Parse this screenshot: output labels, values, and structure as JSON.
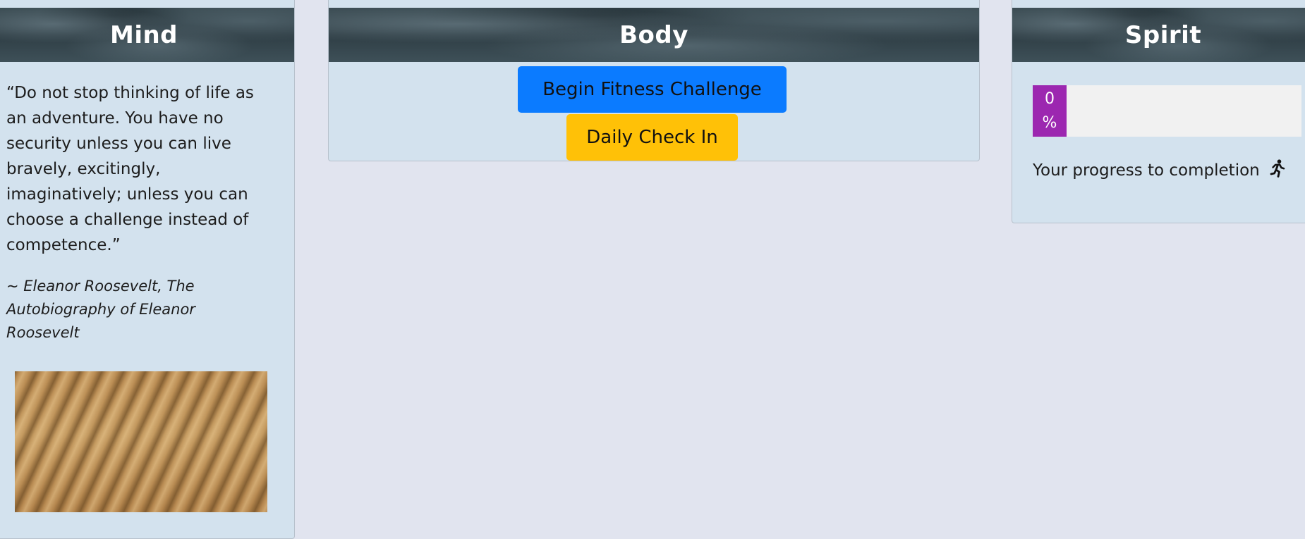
{
  "mind": {
    "title": "Mind",
    "quote": "“Do not stop thinking of life as an adventure. You have no security unless you can live bravely, excitingly, imaginatively; unless you can choose a challenge instead of competence.”",
    "attribution": "~ Eleanor Roosevelt, The Autobiography of Eleanor Roosevelt"
  },
  "body": {
    "title": "Body",
    "begin_label": "Begin Fitness Challenge",
    "checkin_label": "Daily Check In"
  },
  "spirit": {
    "title": "Spirit",
    "progress_value": "0",
    "progress_unit": "%",
    "progress_percent": 0,
    "caption": "Your progress to completion",
    "caption_icon": "running-person-icon"
  },
  "colors": {
    "page_background": "#e1e4ef",
    "card_background": "#d3e2ee",
    "primary_button": "#0b7bff",
    "warning_button": "#ffc107",
    "progress_fill": "#9c27b0",
    "progress_track": "#f1f1f1"
  }
}
